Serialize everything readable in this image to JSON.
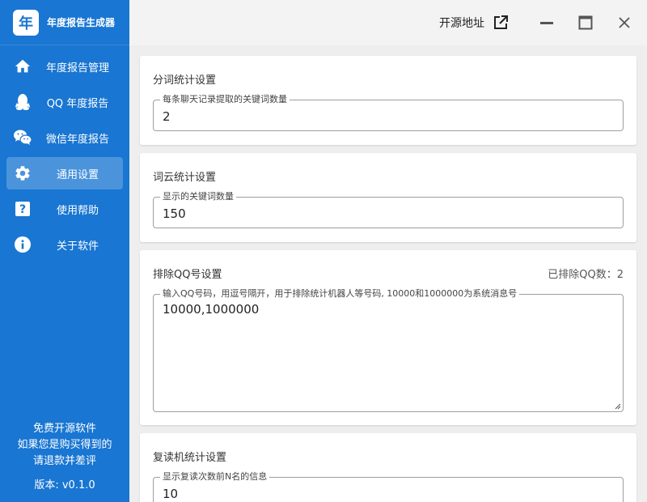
{
  "app": {
    "logo_char": "年",
    "title": "年度报告生成器"
  },
  "sidebar": {
    "items": [
      {
        "label": "年度报告管理",
        "icon": "home-icon",
        "active": false
      },
      {
        "label": "QQ 年度报告",
        "icon": "qq-penguin-icon",
        "active": false
      },
      {
        "label": "微信年度报告",
        "icon": "wechat-icon",
        "active": false
      },
      {
        "label": "通用设置",
        "icon": "gear-icon",
        "active": true
      },
      {
        "label": "使用帮助",
        "icon": "help-icon",
        "active": false
      },
      {
        "label": "关于软件",
        "icon": "info-icon",
        "active": false
      }
    ],
    "footer": {
      "line1": "免费开源软件",
      "line2": "如果您是购买得到的",
      "line3": "请退款并差评",
      "version": "版本: v0.1.0"
    }
  },
  "titlebar": {
    "open_source_link": "开源地址",
    "icons": [
      "external-link-icon",
      "minimize-icon",
      "maximize-icon",
      "close-icon"
    ]
  },
  "sections": {
    "word_segment": {
      "title": "分词统计设置",
      "field_label": "每条聊天记录提取的关键词数量",
      "field_value": "2"
    },
    "word_cloud": {
      "title": "词云统计设置",
      "field_label": "显示的关键词数量",
      "field_value": "150"
    },
    "exclude_qq": {
      "title": "排除QQ号设置",
      "excluded_count": "已排除QQ数：2",
      "field_label": "输入QQ号码，用逗号隔开，用于排除统计机器人等号码, 10000和1000000为系统消息号",
      "field_value": "10000,1000000"
    },
    "repeater": {
      "title": "复读机统计设置",
      "field_label": "显示复读次数前N名的信息",
      "field_value": "10"
    }
  },
  "colors": {
    "sidebar_bg": "#1976d2",
    "content_bg": "#eeeeee",
    "titlebar_bg": "#f3f3f3"
  }
}
